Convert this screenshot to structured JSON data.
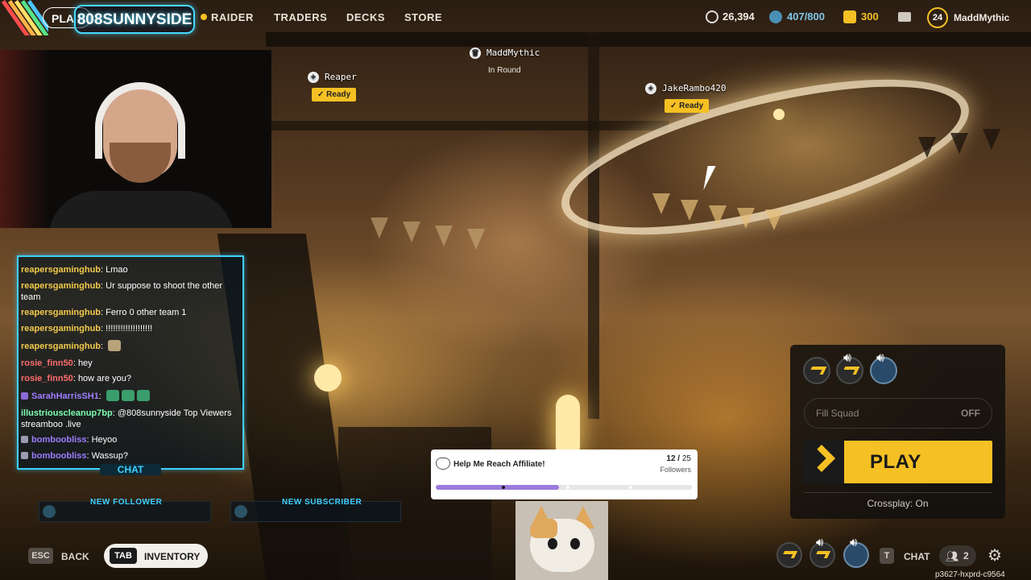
{
  "topnav": {
    "play_label": "PLA",
    "channel_name": "808SUNNYSIDE",
    "items": [
      "RAIDER",
      "TRADERS",
      "DECKS",
      "STORE"
    ],
    "stats": {
      "credits": "26,394",
      "capacity": "407/800",
      "currency": "300"
    },
    "level": "24",
    "username": "MaddMythic"
  },
  "players": [
    {
      "name": "MaddMythic",
      "status": "In Round"
    },
    {
      "name": "Reaper",
      "status": "Ready"
    },
    {
      "name": "JakeRambo420",
      "status": "Ready"
    }
  ],
  "chat": {
    "tab_label": "CHAT",
    "messages": [
      {
        "user": "reapersgaminghub",
        "text": "Lmao"
      },
      {
        "user": "reapersgaminghub",
        "text": "Ur suppose to shoot the other team"
      },
      {
        "user": "reapersgaminghub",
        "text": "Ferro 0 other team 1"
      },
      {
        "user": "reapersgaminghub",
        "text": "!!!!!!!!!!!!!!!!!!!"
      },
      {
        "user": "reapersgaminghub",
        "text": ""
      },
      {
        "user": "rosie_finn50",
        "text": "hey"
      },
      {
        "user": "rosie_finn50",
        "text": "how are you?"
      },
      {
        "user": "SarahHarrisSH1",
        "text": ""
      },
      {
        "user": "illustriouscleanup7bp",
        "text": "@808sunnyside Top Viewers streamboo .live"
      },
      {
        "user": "bomboobliss",
        "text": "Heyoo"
      },
      {
        "user": "bomboobliss",
        "text": "Wassup?"
      }
    ],
    "alerts": {
      "follower_label": "NEW FOLLOWER",
      "subscriber_label": "NEW SUBSCRIBER"
    }
  },
  "affiliate": {
    "title": "Help Me Reach Affiliate!",
    "current": "12",
    "goal": "25",
    "unit": "Followers",
    "progress": 0.48
  },
  "play_panel": {
    "fill_squad_label": "Fill Squad",
    "fill_squad_value": "OFF",
    "play_label": "PLAY",
    "crossplay_text": "Crossplay: On"
  },
  "bottom": {
    "esc_key": "ESC",
    "back_label": "BACK",
    "tab_key": "TAB",
    "inventory_label": "INVENTORY",
    "t_key": "T",
    "chat_label": "CHAT",
    "friends_count": "2",
    "session_id": "p3627-hxprd-c9564"
  },
  "colors": {
    "accent_gold": "#f5c023",
    "chat_border": "#3fd0ff",
    "progress_fill": "#9b7bdc"
  }
}
